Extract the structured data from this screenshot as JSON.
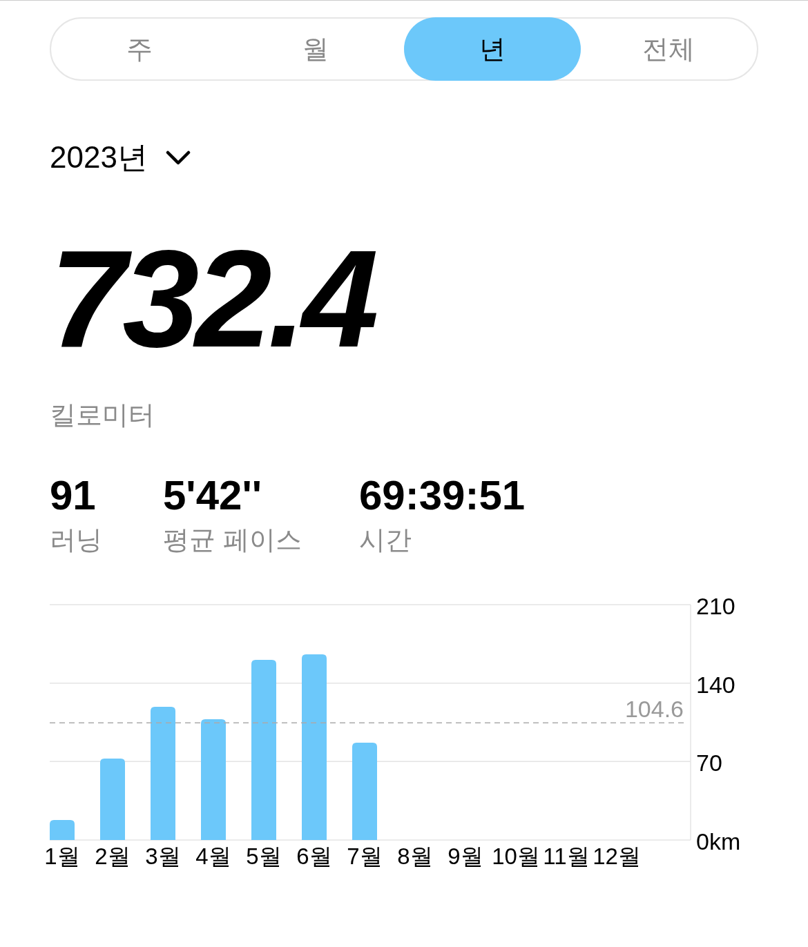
{
  "tabs": [
    {
      "label": "주",
      "selected": false
    },
    {
      "label": "월",
      "selected": false
    },
    {
      "label": "년",
      "selected": true
    },
    {
      "label": "전체",
      "selected": false
    }
  ],
  "period_selector": {
    "label": "2023년"
  },
  "total": {
    "value": "732.4",
    "unit": "킬로미터"
  },
  "stats": [
    {
      "value": "91",
      "label": "러닝"
    },
    {
      "value": "5'42''",
      "label": "평균 페이스"
    },
    {
      "value": "69:39:51",
      "label": "시간"
    }
  ],
  "chart": {
    "chart_data": {
      "type": "bar",
      "categories": [
        "1월",
        "2월",
        "3월",
        "4월",
        "5월",
        "6월",
        "7월",
        "8월",
        "9월",
        "10월",
        "11월",
        "12월"
      ],
      "values": [
        17.9,
        72.7,
        118.8,
        107.8,
        160.7,
        165.6,
        86.8,
        null,
        null,
        null,
        null,
        null
      ],
      "ylim": [
        0,
        210
      ],
      "yticks": [
        {
          "value": 0,
          "label": "0km"
        },
        70,
        140,
        210
      ],
      "ref_lines": [
        {
          "axis": "y",
          "value": 104.6,
          "label": "104.6"
        }
      ]
    }
  }
}
